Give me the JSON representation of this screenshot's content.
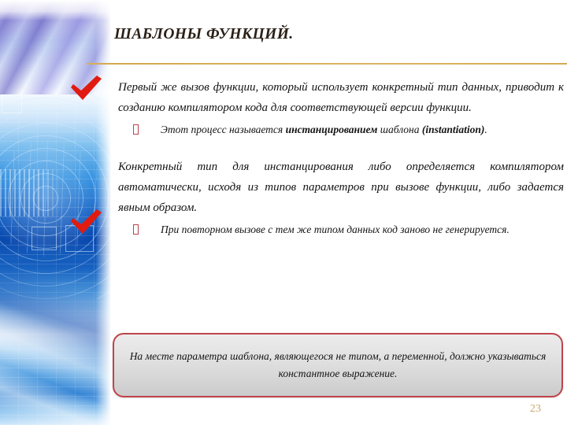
{
  "slide": {
    "title": "ШАБЛОНЫ ФУНКЦИЙ.",
    "page_number": "23",
    "accent_rule_color": "#d4a84f",
    "check_color": "#e01b10",
    "callout_border_color": "#c0434a",
    "callout_fill_color": "#e2e2e3",
    "page_number_color": "#c9a96b",
    "title_color": "#2b2017",
    "bullet_color": "#b8434c"
  },
  "body": {
    "block1": {
      "check_icon": "red-check-icon",
      "paragraph": "Первый же вызов функции, который использует конкретный тип данных, приводит к созданию компилятором кода для соответствующей версии функции.",
      "sub": {
        "bullet_icon": "square-outline-bullet-icon",
        "text_before": "Этот процесс называется ",
        "bold_term": "инстанцированием",
        "text_middle": " шаблона ",
        "bold_latin": "(instantiation)",
        "text_after": "."
      }
    },
    "block2": {
      "check_icon": "red-check-icon",
      "paragraph": "Конкретный тип для инстанцирования либо определяется компилятором автоматически, исходя из типов параметров при вызове функции, либо задается явным образом.",
      "sub": {
        "bullet_icon": "square-outline-bullet-icon",
        "text": "При повторном вызове с тем же типом данных код заново не генерируется."
      }
    }
  },
  "callout": {
    "text": "На месте параметра шаблона, являющегося не типом, а переменной, должно указываться константное выражение."
  },
  "decoration": {
    "strip_name": "blue-technology-globe-image"
  }
}
